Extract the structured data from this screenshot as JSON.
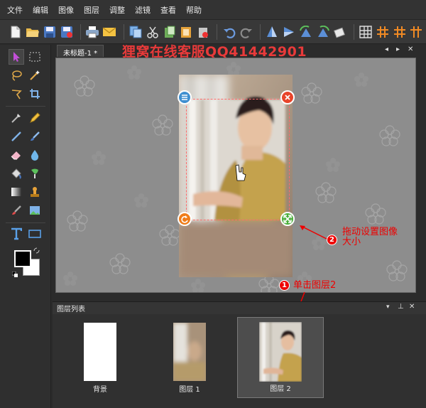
{
  "menu": [
    "文件",
    "编辑",
    "图像",
    "图层",
    "调整",
    "滤镜",
    "查看",
    "帮助"
  ],
  "document": {
    "tab_title": "未标题-1 *"
  },
  "watermark": "狸窝在线客服QQ41442901",
  "layer_panel": {
    "title": "图层列表",
    "layers": [
      {
        "name": "背景"
      },
      {
        "name": "图层 1"
      },
      {
        "name": "图层 2"
      }
    ],
    "selected_layer": "图层 2"
  },
  "annotations": {
    "step1": {
      "badge": "1",
      "text": "单击图层2"
    },
    "step2": {
      "badge": "2",
      "line1": "拖动设置图像",
      "line2": "大小"
    }
  },
  "icons": {
    "toolbar": [
      "new-file-icon",
      "open-folder-icon",
      "save-icon",
      "save-as-icon",
      "print-icon",
      "email-icon",
      "copy-icon",
      "cut-icon",
      "paste-icon",
      "paste-new-icon",
      "delete-icon",
      "undo-icon",
      "redo-icon",
      "flip-vertical-icon",
      "flip-horizontal-icon",
      "rotate-left-icon",
      "rotate-right-icon",
      "free-rotate-icon",
      "grid-icon",
      "guides-icon",
      "snap-icon"
    ],
    "tools": [
      "move-icon",
      "marquee-icon",
      "lasso-icon",
      "magic-wand-icon",
      "polygon-lasso-icon",
      "crop-icon",
      "eyedropper-icon",
      "pencil-icon",
      "line-icon",
      "brush-icon",
      "eraser-icon",
      "blur-icon",
      "fill-bucket-icon",
      "clone-icon",
      "gradient-icon",
      "stamp-icon",
      "effects-brush-icon",
      "insert-image-icon",
      "text-icon",
      "rectangle-icon"
    ]
  },
  "colors": {
    "accent_red": "#e00000",
    "selection_dash": "#ff6b6b",
    "handle_blue": "#3f8fd0",
    "handle_red": "#e8442a",
    "handle_orange": "#f07d1a",
    "handle_green": "#4caf3c",
    "foreground": "#000000",
    "background": "#ffffff"
  }
}
